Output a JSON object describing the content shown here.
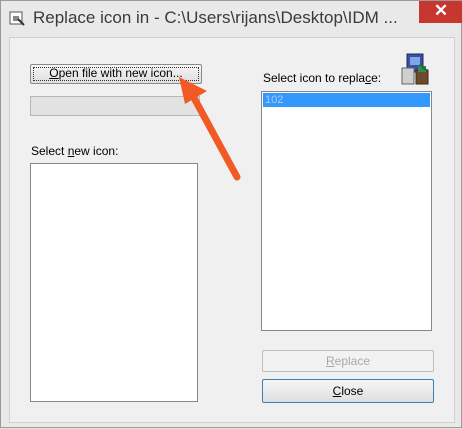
{
  "window": {
    "title": "Replace icon in - C:\\Users\\rijans\\Desktop\\IDM ...",
    "close_glyph": "✕"
  },
  "left": {
    "open_button": {
      "pre": "",
      "accel": "O",
      "post": "pen file with new icon..."
    },
    "new_icon_label": {
      "pre": "Select ",
      "accel": "n",
      "post": "ew icon:"
    }
  },
  "right": {
    "replace_label": {
      "pre": "Select icon to repla",
      "accel": "c",
      "post": "e:"
    },
    "icons": [
      "102"
    ],
    "selected_icon": "102"
  },
  "buttons": {
    "replace": {
      "pre": "",
      "accel": "R",
      "post": "eplace"
    },
    "close": {
      "pre": "",
      "accel": "C",
      "post": "lose"
    }
  },
  "colors": {
    "selection": "#3399ff",
    "arrow": "#f15a24"
  }
}
